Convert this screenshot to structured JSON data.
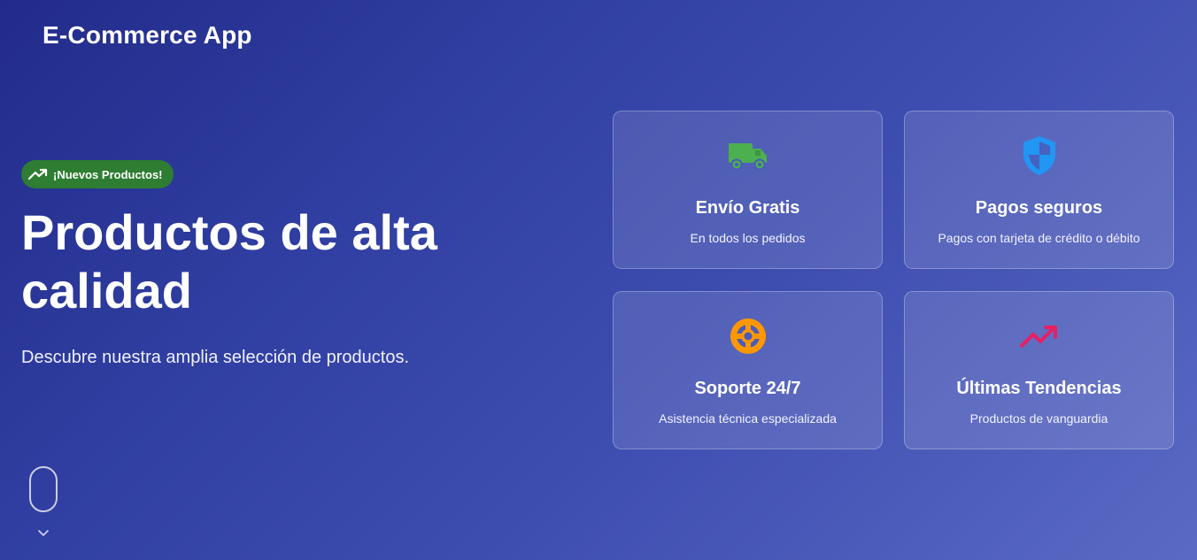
{
  "header": {
    "app_title": "E-Commerce App"
  },
  "hero": {
    "badge_label": "¡Nuevos Productos!",
    "badge_icon": "trending-up-icon",
    "title": "Productos de alta calidad",
    "subtitle": "Descubre nuestra amplia selección de productos."
  },
  "features": [
    {
      "icon": "truck-icon",
      "icon_color": "#4caf50",
      "title": "Envío Gratis",
      "description": "En todos los pedidos"
    },
    {
      "icon": "shield-icon",
      "icon_color": "#2196f3",
      "title": "Pagos seguros",
      "description": "Pagos con tarjeta de crédito o débito"
    },
    {
      "icon": "support-icon",
      "icon_color": "#ff9800",
      "title": "Soporte 24/7",
      "description": "Asistencia técnica especializada"
    },
    {
      "icon": "trending-up-icon",
      "icon_color": "#e91e63",
      "title": "Últimas Tendencias",
      "description": "Productos de vanguardia"
    }
  ],
  "colors": {
    "background_start": "#222b8a",
    "background_end": "#5a6ac4",
    "badge_bg": "#2e7d32"
  }
}
